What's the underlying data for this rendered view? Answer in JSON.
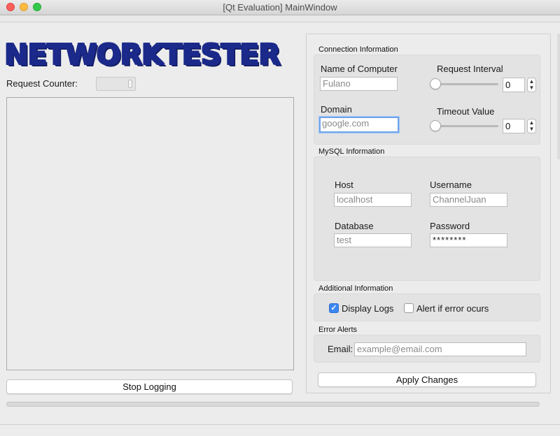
{
  "window": {
    "title": "[Qt Evaluation] MainWindow"
  },
  "logo": {
    "text": "NETWORKTESTER",
    "accent": "#6f8fe8",
    "outline": "#1b2a8a"
  },
  "left": {
    "request_counter_label": "Request Counter:",
    "stop_button": "Stop Logging"
  },
  "connection": {
    "group_title": "Connection Information",
    "name_label": "Name of Computer",
    "name_value": "Fulano",
    "interval_label": "Request Interval",
    "interval_value": "0",
    "domain_label": "Domain",
    "domain_value": "google.com",
    "timeout_label": "Timeout Value",
    "timeout_value": "0"
  },
  "mysql": {
    "group_title": "MySQL Information",
    "host_label": "Host",
    "host_value": "localhost",
    "username_label": "Username",
    "username_value": "ChannelJuan",
    "database_label": "Database",
    "database_value": "test",
    "password_label": "Password",
    "password_value": "********"
  },
  "additional": {
    "group_title": "Additional Information",
    "display_logs_label": "Display Logs",
    "display_logs_checked": true,
    "alert_label": "Alert if error ocurs",
    "alert_checked": false
  },
  "errors": {
    "group_title": "Error Alerts",
    "email_label": "Email:",
    "email_placeholder": "example@email.com"
  },
  "actions": {
    "apply_button": "Apply Changes"
  },
  "colors": {
    "checkbox_on": "#3b86f2",
    "focus_ring": "#6fa4ec"
  }
}
